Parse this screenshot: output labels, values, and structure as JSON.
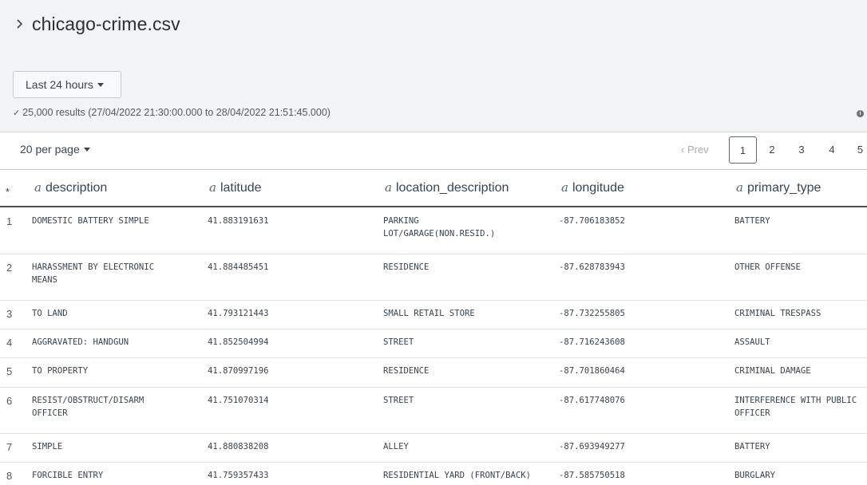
{
  "header": {
    "title": "chicago-crime.csv",
    "time_range_label": "Last 24 hours",
    "results_check": "✓",
    "results_text": "25,000 results (27/04/2022 21:30:00.000 to 28/04/2022 21:51:45.000)",
    "info_icon": "info-icon"
  },
  "pager": {
    "per_page_label": "20 per page",
    "prev_label": "‹ Prev",
    "pages": [
      "1",
      "2",
      "3",
      "4",
      "5"
    ],
    "active_page": "1"
  },
  "table": {
    "row_number_header": "*",
    "type_glyph": "a",
    "columns": [
      "description",
      "latitude",
      "location_description",
      "longitude",
      "primary_type"
    ],
    "rows": [
      {
        "n": "1",
        "description": "DOMESTIC BATTERY SIMPLE",
        "latitude": "41.883191631",
        "location_description": [
          "PARKING",
          "LOT/GARAGE(NON.RESID.)"
        ],
        "longitude": "-87.706183852",
        "primary_type": "BATTERY"
      },
      {
        "n": "2",
        "description": [
          "HARASSMENT BY ELECTRONIC",
          "MEANS"
        ],
        "latitude": "41.884485451",
        "location_description": "RESIDENCE",
        "longitude": "-87.628783943",
        "primary_type": "OTHER OFFENSE"
      },
      {
        "n": "3",
        "description": "TO LAND",
        "latitude": "41.793121443",
        "location_description": "SMALL RETAIL STORE",
        "longitude": "-87.732255805",
        "primary_type": "CRIMINAL TRESPASS"
      },
      {
        "n": "4",
        "description": "AGGRAVATED: HANDGUN",
        "latitude": "41.852504994",
        "location_description": "STREET",
        "longitude": "-87.716243608",
        "primary_type": "ASSAULT"
      },
      {
        "n": "5",
        "description": "TO PROPERTY",
        "latitude": "41.870997196",
        "location_description": "RESIDENCE",
        "longitude": "-87.701860464",
        "primary_type": "CRIMINAL DAMAGE"
      },
      {
        "n": "6",
        "description": [
          "RESIST/OBSTRUCT/DISARM",
          "OFFICER"
        ],
        "latitude": "41.751070314",
        "location_description": "STREET",
        "longitude": "-87.617748076",
        "primary_type": [
          "INTERFERENCE WITH PUBLIC",
          "OFFICER"
        ]
      },
      {
        "n": "7",
        "description": "SIMPLE",
        "latitude": "41.880838208",
        "location_description": "ALLEY",
        "longitude": "-87.693949277",
        "primary_type": "BATTERY"
      },
      {
        "n": "8",
        "description": "FORCIBLE ENTRY",
        "latitude": "41.759357433",
        "location_description": "RESIDENTIAL YARD (FRONT/BACK)",
        "longitude": "-87.585750518",
        "primary_type": "BURGLARY"
      }
    ]
  }
}
